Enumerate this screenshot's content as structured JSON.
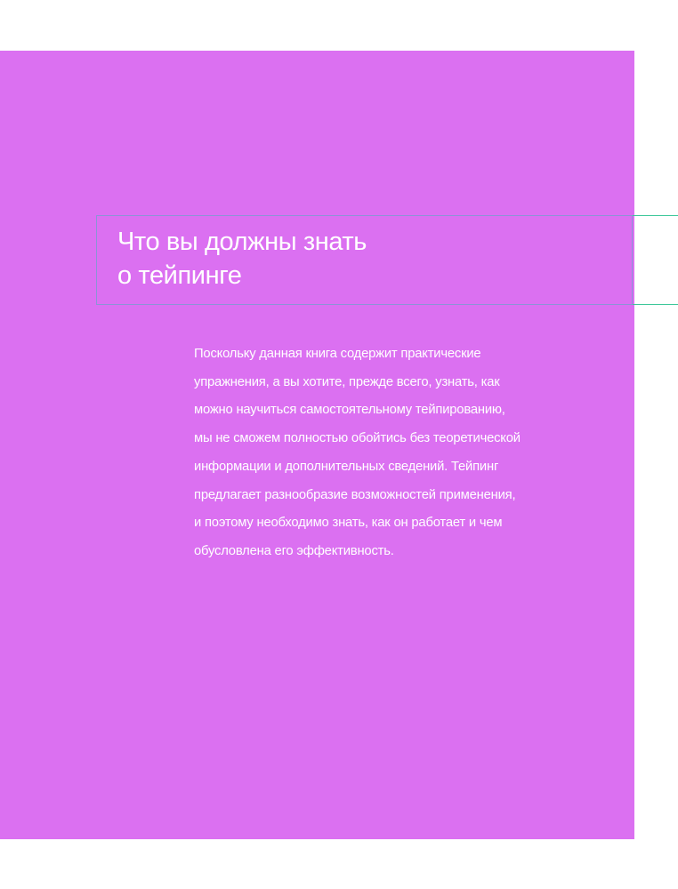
{
  "page": {
    "background_color": "#ffffff",
    "panel_color": "#db70f1",
    "frame_color": "#8c93d6",
    "rule_color": "#3ec89a"
  },
  "heading": {
    "title": "Что вы должны знать\nо тейпинге"
  },
  "content": {
    "paragraph": "Поскольку данная книга содержит практические\nупражнения, а вы хотите, прежде всего, узнать, как\nможно научиться самостоятельному тейпированию,\nмы не сможем полностью обойтись без теоретической\nинформации и дополнительных сведений. Тейпинг\nпредлагает разнообразие возможностей применения,\nи поэтому необходимо знать, как он работает и чем\nобусловлена его эффективность."
  }
}
